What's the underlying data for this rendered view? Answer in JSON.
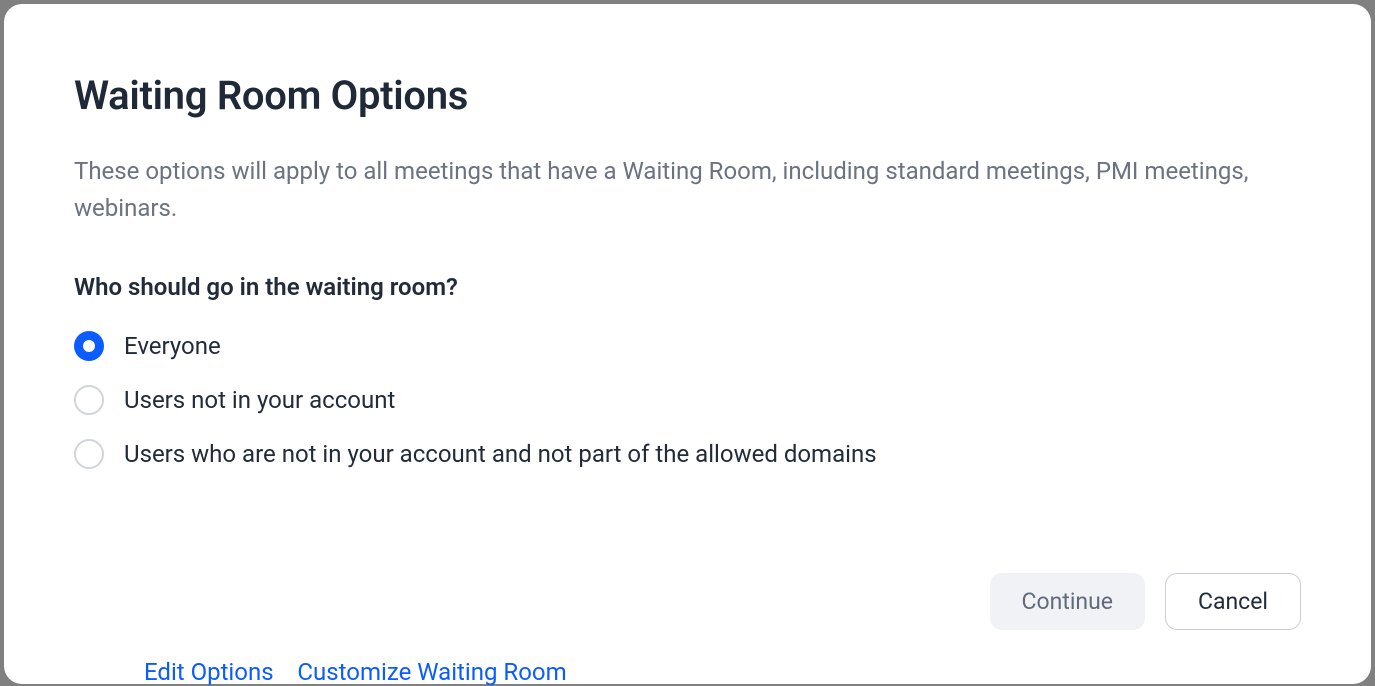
{
  "modal": {
    "title": "Waiting Room Options",
    "description": "These options will apply to all meetings that have a Waiting Room, including standard meetings, PMI meetings, webinars.",
    "question": "Who should go in the waiting room?",
    "options": [
      {
        "label": "Everyone",
        "selected": true
      },
      {
        "label": "Users not in your account",
        "selected": false
      },
      {
        "label": "Users who are not in your account and not part of the allowed domains",
        "selected": false
      }
    ],
    "buttons": {
      "continue": "Continue",
      "cancel": "Cancel"
    }
  },
  "background": {
    "edit_options": "Edit Options",
    "customize": "Customize Waiting Room"
  }
}
